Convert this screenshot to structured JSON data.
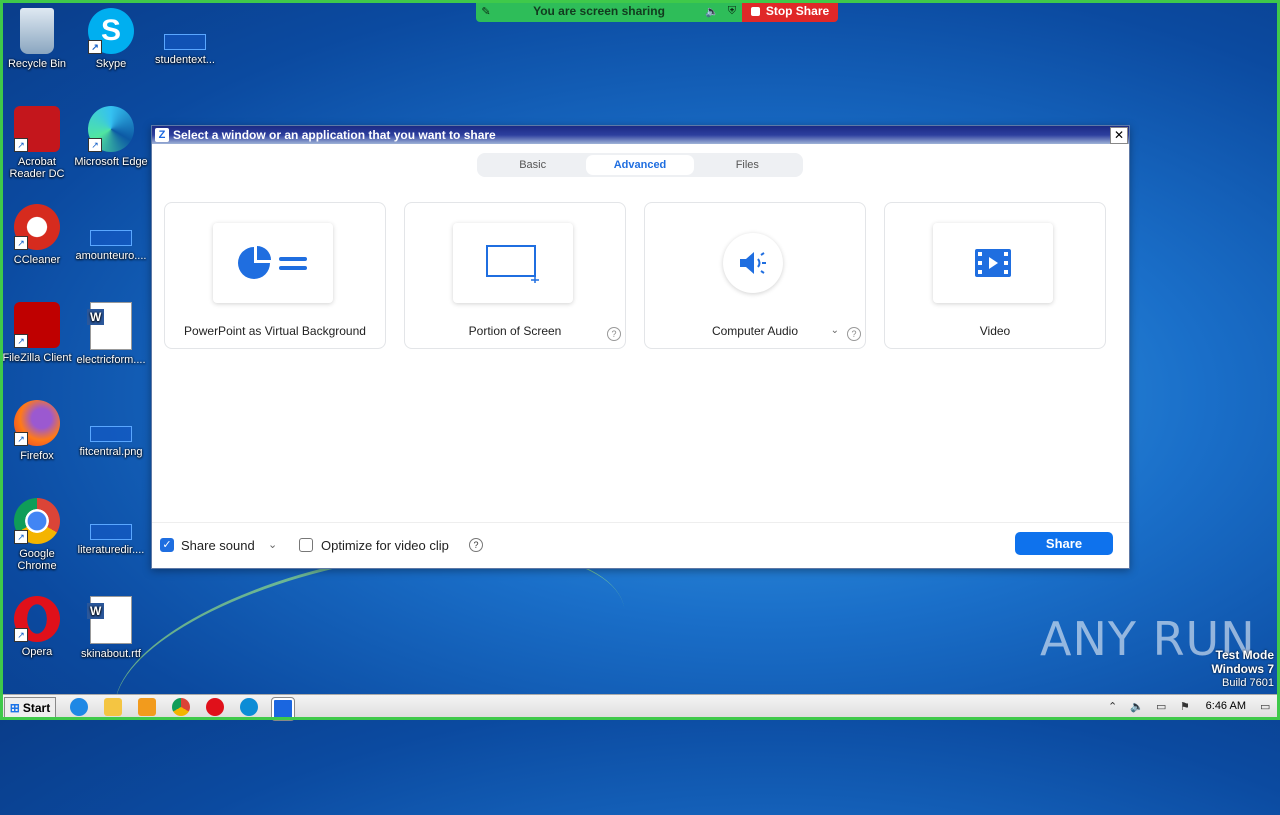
{
  "share_bar": {
    "status_text": "You are screen sharing",
    "stop_label": "Stop Share"
  },
  "desktop_icons": [
    {
      "label": "Recycle Bin",
      "icon": "recycle-bin-icon"
    },
    {
      "label": "Skype",
      "icon": "skype-icon"
    },
    {
      "label": "studentext...",
      "icon": "file-icon"
    },
    {
      "label": "Acrobat Reader DC",
      "icon": "acrobat-icon"
    },
    {
      "label": "Microsoft Edge",
      "icon": "edge-icon"
    },
    {
      "label": "CCleaner",
      "icon": "ccleaner-icon"
    },
    {
      "label": "amounteuro....",
      "icon": "file-icon"
    },
    {
      "label": "FileZilla Client",
      "icon": "filezilla-icon"
    },
    {
      "label": "electricform....",
      "icon": "word-doc-icon"
    },
    {
      "label": "Firefox",
      "icon": "firefox-icon"
    },
    {
      "label": "fitcentral.png",
      "icon": "file-icon"
    },
    {
      "label": "Google Chrome",
      "icon": "chrome-icon"
    },
    {
      "label": "literaturedir....",
      "icon": "file-icon"
    },
    {
      "label": "Opera",
      "icon": "opera-icon"
    },
    {
      "label": "skinabout.rtf",
      "icon": "word-doc-icon"
    }
  ],
  "dialog": {
    "title": "Select a window or an application that you want to share",
    "tabs": [
      "Basic",
      "Advanced",
      "Files"
    ],
    "active_tab": "Advanced",
    "cards": [
      {
        "label": "PowerPoint as Virtual Background",
        "icon": "powerpoint-background-icon"
      },
      {
        "label": "Portion of Screen",
        "icon": "portion-of-screen-icon"
      },
      {
        "label": "Computer Audio",
        "icon": "speaker-icon"
      },
      {
        "label": "Video",
        "icon": "video-icon"
      }
    ],
    "footer": {
      "share_sound": {
        "label": "Share sound",
        "checked": true
      },
      "optimize_video": {
        "label": "Optimize for video clip",
        "checked": false
      },
      "share_button": "Share"
    }
  },
  "taskbar": {
    "start_label": "Start",
    "clock": "6:46 AM"
  },
  "watermark": {
    "mode": "Test Mode",
    "os": "Windows 7",
    "build": "Build 7601",
    "brand": "ANY RUN"
  },
  "colors": {
    "accent": "#0e72ed",
    "share_bar": "#2ebd59",
    "stop_share": "#e02828"
  }
}
